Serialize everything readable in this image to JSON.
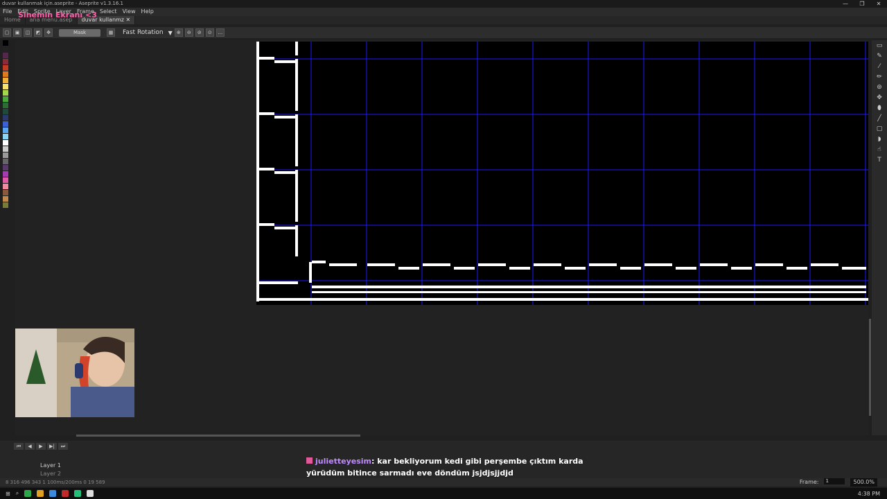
{
  "window": {
    "title": "duvar kullanmak için.aseprite - Aseprite v1.3.16.1",
    "controls": [
      "—",
      "❐",
      "✕"
    ]
  },
  "stream_title": "Sinemin Ekranı <3",
  "menu": [
    "File",
    "Edit",
    "Sprite",
    "Layer",
    "Frame",
    "Select",
    "View",
    "Help"
  ],
  "tabs": [
    "Home",
    "ana menu.asep",
    "duvar kullanmz ✕"
  ],
  "toolbar": {
    "mask_label": "Mask",
    "rotation_label": "Fast Rotation"
  },
  "layers": [
    "Layer 1",
    "Layer 2"
  ],
  "chat": {
    "user": "julietteyesim",
    "message": ": kar bekliyorum kedi gibi perşembe çıktım karda yürüdüm bitince sarmadı eve döndüm jsjdjsjjdjd"
  },
  "status": {
    "left": "8 316   496 343   1   100ms/200ms   0 19   589",
    "frame_label": "Frame:",
    "frame_value": "1",
    "zoom": "500.0%"
  },
  "clock": "4:38 PM",
  "colors": {
    "grid": "#1a1aff",
    "wall": "#ffffff",
    "sprite_bg": "#000000",
    "accent": "#ff5fa8"
  }
}
